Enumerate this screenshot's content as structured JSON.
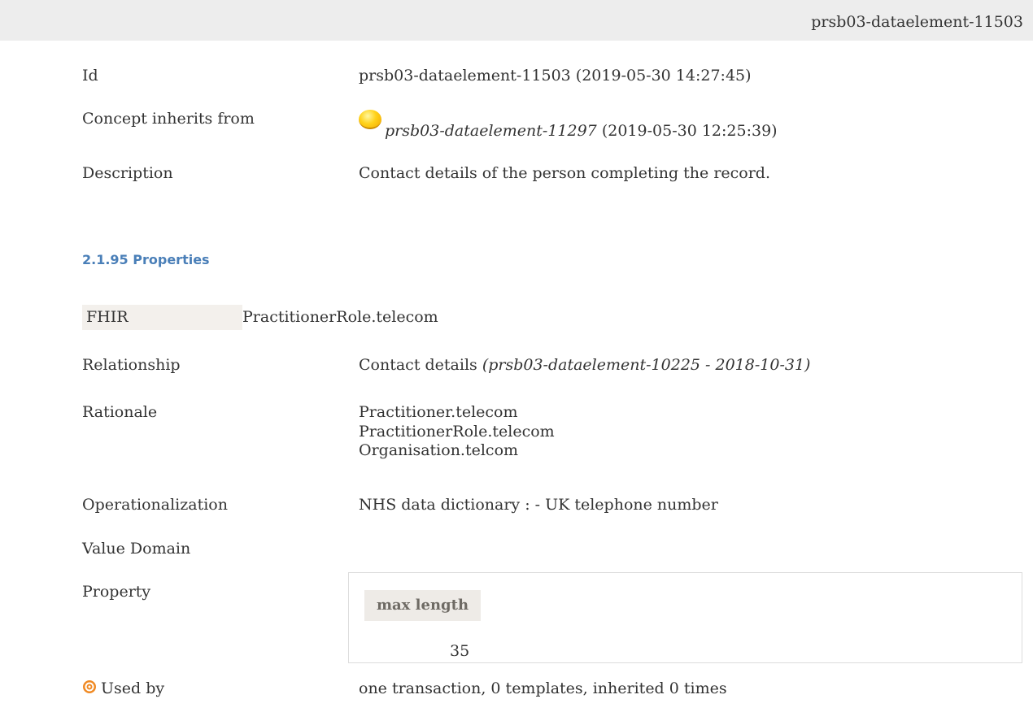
{
  "header": {
    "title": "prsb03-dataelement-11503"
  },
  "details": {
    "id_label": "Id",
    "id_value": "prsb03-dataelement-11503 (2019-05-30 14:27:45)",
    "inherits_label": "Concept inherits from",
    "inherits_link": "prsb03-dataelement-11297",
    "inherits_date": "(2019-05-30 12:25:39)",
    "description_label": "Description",
    "description_value": "Contact details of the person completing the record."
  },
  "section": {
    "heading": "2.1.95 Properties"
  },
  "fhir": {
    "label": "FHIR",
    "value": "PractitionerRole.telecom"
  },
  "properties": {
    "relationship_label": "Relationship",
    "relationship_value": "Contact details",
    "relationship_ref": "(prsb03-dataelement-10225 - 2018-10-31)",
    "rationale_label": "Rationale",
    "rationale_lines": [
      "Practitioner.telecom",
      "PractitionerRole.telecom",
      "Organisation.telcom"
    ],
    "operationalization_label": "Operationalization",
    "operationalization_value": "NHS data dictionary : - UK telephone number",
    "value_domain_label": "Value Domain",
    "property_label": "Property",
    "property_table": {
      "header": "max length",
      "value": "35"
    },
    "used_by_label": "Used by",
    "used_by_value": "one transaction, 0 templates, inherited 0 times"
  },
  "colors": {
    "heading": "#4a7fb8",
    "topbar": "#ededed",
    "fhir_label_bg": "#f3f0ec",
    "prop_header_bg": "#eeebe7",
    "target_icon": "#f08a24"
  },
  "icons": {
    "inherits": "yellow-dot-icon",
    "used_by": "target-icon"
  }
}
